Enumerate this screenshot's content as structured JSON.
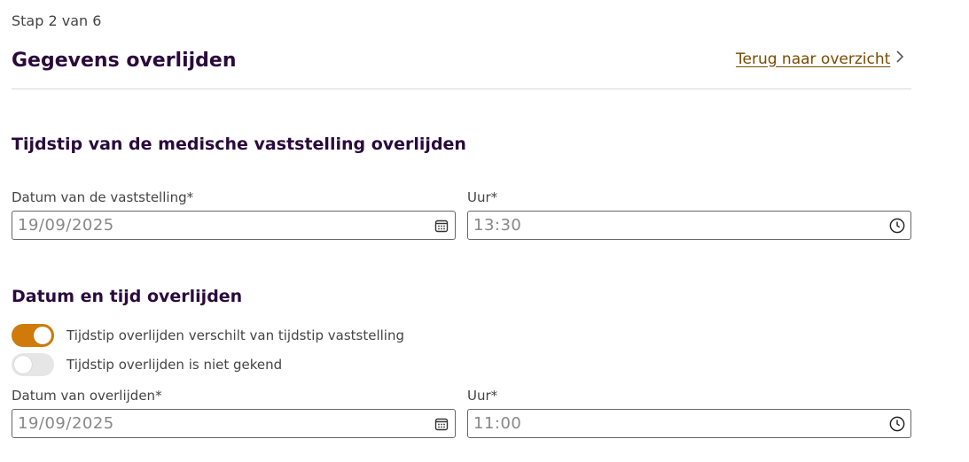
{
  "header": {
    "step": "Stap 2 van 6",
    "title": "Gegevens overlijden",
    "back_link": "Terug naar overzicht"
  },
  "section1": {
    "title": "Tijdstip van de medische vaststelling overlijden",
    "date_label": "Datum van de vaststelling*",
    "date_value": "19/09/2025",
    "time_label": "Uur*",
    "time_value": "13:30"
  },
  "section2": {
    "title": "Datum en tijd overlijden",
    "toggle1_label": "Tijdstip overlijden verschilt van tijdstip vaststelling",
    "toggle1_on": true,
    "toggle2_label": "Tijdstip overlijden is niet gekend",
    "toggle2_on": false,
    "date_label": "Datum van overlijden*",
    "date_value": "19/09/2025",
    "time_label": "Uur*",
    "time_value": "11:00"
  },
  "colors": {
    "title": "#2a0a3d",
    "link": "#7a4a00",
    "toggle_on": "#d07a0a",
    "toggle_off": "#e6e6e6"
  }
}
